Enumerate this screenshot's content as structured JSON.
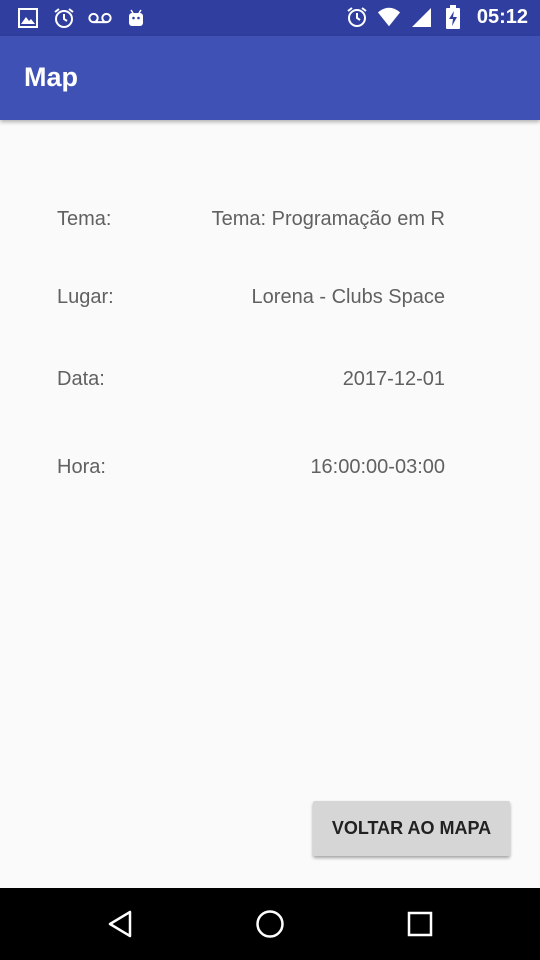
{
  "status_bar": {
    "time": "05:12",
    "left_icons": [
      "image-icon",
      "alarm-icon",
      "voicemail-icon",
      "android-icon"
    ],
    "right_icons": [
      "alarm-icon",
      "wifi-icon",
      "signal-icon",
      "battery-charging-icon"
    ],
    "background": "#303f9f"
  },
  "app_bar": {
    "title": "Map",
    "background": "#3f51b5"
  },
  "details": {
    "tema": {
      "label": "Tema:",
      "value": "Tema: Programação em R"
    },
    "lugar": {
      "label": "Lugar:",
      "value": "Lorena - Clubs Space"
    },
    "data": {
      "label": "Data:",
      "value": "2017-12-01"
    },
    "hora": {
      "label": "Hora:",
      "value": "16:00:00-03:00"
    }
  },
  "actions": {
    "back_to_map": "VOLTAR AO MAPA"
  },
  "nav_bar": {
    "buttons": [
      "back-icon",
      "home-icon",
      "recents-icon"
    ]
  }
}
